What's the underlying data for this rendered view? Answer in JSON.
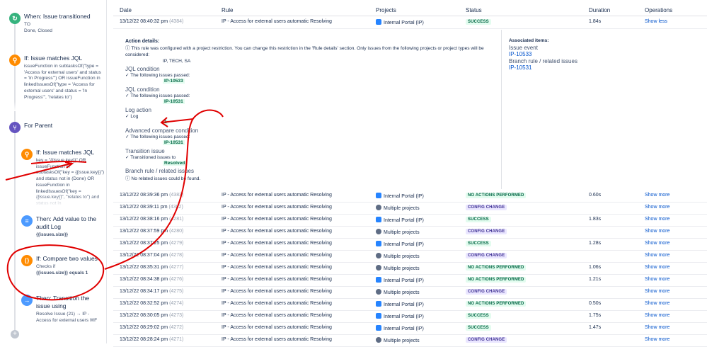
{
  "rule_steps": {
    "when_transitioned": {
      "title": "When: Issue transitioned",
      "line1": "TO",
      "line2": "Done, Closed"
    },
    "if_jql_1": {
      "title": "If: Issue matches JQL",
      "body": "issueFunction in subtasksOf(\"type = 'Access for external users' and status = 'In Progress'\") OR issueFunction in linkedIssuesOf(\"type = 'Access for external users' and status = 'In Progress'\", \"relates to\")"
    },
    "for_parent": {
      "title": "For Parent"
    },
    "if_jql_2": {
      "title": "If: Issue matches JQL",
      "body": "key = \"{{issue.key}}\" OR issueFunction in subtasksOf(\"key = {{issue.key}}\") and status not in (Done) OR issueFunction in linkedIssuesOf(\"key = {{issue.key}}\", \"relates to\") and status not in"
    },
    "add_audit": {
      "title": "Then: Add value to the audit Log",
      "body": "{{issues.size}}"
    },
    "compare": {
      "title": "If: Compare two values",
      "line1": "Checks if",
      "line2": "{{issues.size}} equals 1"
    },
    "transition": {
      "title": "Then: Transition the issue using",
      "body": "Resolve Issue (21) → IP - Access for external users WF"
    }
  },
  "table": {
    "headers": {
      "date": "Date",
      "rule": "Rule",
      "projects": "Projects",
      "status": "Status",
      "duration": "Duration",
      "operations": "Operations"
    },
    "first_row": {
      "date": "13/12/22 08:40:32 pm",
      "num": "(4384)",
      "rule": "IP - Access for external users automatic Resolving",
      "project": "Internal Portal (IP)",
      "status": "SUCCESS",
      "duration": "1.84s",
      "op": "Show less"
    },
    "detail": {
      "action_details": "Action details:",
      "restriction_note": "This rule was configured with a project restriction. You can change this restriction in the 'Rule details' section. Only issues from the following projects or project types will be considered:",
      "projects_list": "IP, TECH, SA",
      "jql1_label": "JQL condition",
      "jql1_passed": "The following issues passed:",
      "jql1_issue": "IP-10533",
      "jql2_label": "JQL condition",
      "jql2_passed": "The following issues passed:",
      "jql2_issue": "IP-10531",
      "log_label": "Log action",
      "log_text": "Log",
      "log_value": "1",
      "adv_label": "Advanced compare condition",
      "adv_passed": "The following issues passed:",
      "adv_issue": "IP-10531",
      "trans_label": "Transition issue",
      "trans_text": "Transitioned issues to",
      "trans_value": "Resolved",
      "branch_label": "Branch rule / related issues",
      "branch_text": "No related issues could be found.",
      "assoc_title": "Associated items:",
      "assoc_event_label": "Issue event",
      "assoc_event_issue": "IP-10533",
      "assoc_branch_label": "Branch rule / related issues",
      "assoc_branch_issue": "IP-10531"
    },
    "rows": [
      {
        "date": "13/12/22 08:39:36 pm",
        "num": "(4383)",
        "rule": "IP - Access for external users automatic Resolving",
        "project": "Internal Portal (IP)",
        "proj_type": "ip",
        "status": "NO ACTIONS PERFORMED",
        "status_type": "noact",
        "duration": "0.60s",
        "op": "Show more"
      },
      {
        "date": "13/12/22 08:39:11 pm",
        "num": "(4382)",
        "rule": "IP - Access for external users automatic Resolving",
        "project": "Multiple projects",
        "proj_type": "multi",
        "status": "CONFIG CHANGE",
        "status_type": "config",
        "duration": "",
        "op": "Show more"
      },
      {
        "date": "13/12/22 08:38:16 pm",
        "num": "(4281)",
        "rule": "IP - Access for external users automatic Resolving",
        "project": "Internal Portal (IP)",
        "proj_type": "ip",
        "status": "SUCCESS",
        "status_type": "success",
        "duration": "1.83s",
        "op": "Show more"
      },
      {
        "date": "13/12/22 08:37:59 pm",
        "num": "(4280)",
        "rule": "IP - Access for external users automatic Resolving",
        "project": "Multiple projects",
        "proj_type": "multi",
        "status": "CONFIG CHANGE",
        "status_type": "config",
        "duration": "",
        "op": "Show more"
      },
      {
        "date": "13/12/22 08:37:25 pm",
        "num": "(4279)",
        "rule": "IP - Access for external users automatic Resolving",
        "project": "Internal Portal (IP)",
        "proj_type": "ip",
        "status": "SUCCESS",
        "status_type": "success",
        "duration": "1.28s",
        "op": "Show more"
      },
      {
        "date": "13/12/22 08:37:04 pm",
        "num": "(4278)",
        "rule": "IP - Access for external users automatic Resolving",
        "project": "Multiple projects",
        "proj_type": "multi",
        "status": "CONFIG CHANGE",
        "status_type": "config",
        "duration": "",
        "op": "Show more"
      },
      {
        "date": "13/12/22 08:35:31 pm",
        "num": "(4277)",
        "rule": "IP - Access for external users automatic Resolving",
        "project": "Multiple projects",
        "proj_type": "multi",
        "status": "NO ACTIONS PERFORMED",
        "status_type": "noact",
        "duration": "1.06s",
        "op": "Show more"
      },
      {
        "date": "13/12/22 08:34:38 pm",
        "num": "(4276)",
        "rule": "IP - Access for external users automatic Resolving",
        "project": "Internal Portal (IP)",
        "proj_type": "ip",
        "status": "NO ACTIONS PERFORMED",
        "status_type": "noact",
        "duration": "1.21s",
        "op": "Show more"
      },
      {
        "date": "13/12/22 08:34:17 pm",
        "num": "(4275)",
        "rule": "IP - Access for external users automatic Resolving",
        "project": "Multiple projects",
        "proj_type": "multi",
        "status": "CONFIG CHANGE",
        "status_type": "config",
        "duration": "",
        "op": "Show more"
      },
      {
        "date": "13/12/22 08:32:52 pm",
        "num": "(4274)",
        "rule": "IP - Access for external users automatic Resolving",
        "project": "Internal Portal (IP)",
        "proj_type": "ip",
        "status": "NO ACTIONS PERFORMED",
        "status_type": "noact",
        "duration": "0.50s",
        "op": "Show more"
      },
      {
        "date": "13/12/22 08:30:05 pm",
        "num": "(4273)",
        "rule": "IP - Access for external users automatic Resolving",
        "project": "Internal Portal (IP)",
        "proj_type": "ip",
        "status": "SUCCESS",
        "status_type": "success",
        "duration": "1.75s",
        "op": "Show more"
      },
      {
        "date": "13/12/22 08:29:02 pm",
        "num": "(4272)",
        "rule": "IP - Access for external users automatic Resolving",
        "project": "Internal Portal (IP)",
        "proj_type": "ip",
        "status": "SUCCESS",
        "status_type": "success",
        "duration": "1.47s",
        "op": "Show more"
      },
      {
        "date": "13/12/22 08:28:24 pm",
        "num": "(4271)",
        "rule": "IP - Access for external users automatic Resolving",
        "project": "Multiple projects",
        "proj_type": "multi",
        "status": "CONFIG CHANGE",
        "status_type": "config",
        "duration": "",
        "op": "Show more"
      }
    ]
  },
  "colors": {
    "annotation": "#e00000",
    "link": "#0052cc",
    "success_bg": "#e3fcef",
    "config_bg": "#eae6ff"
  }
}
